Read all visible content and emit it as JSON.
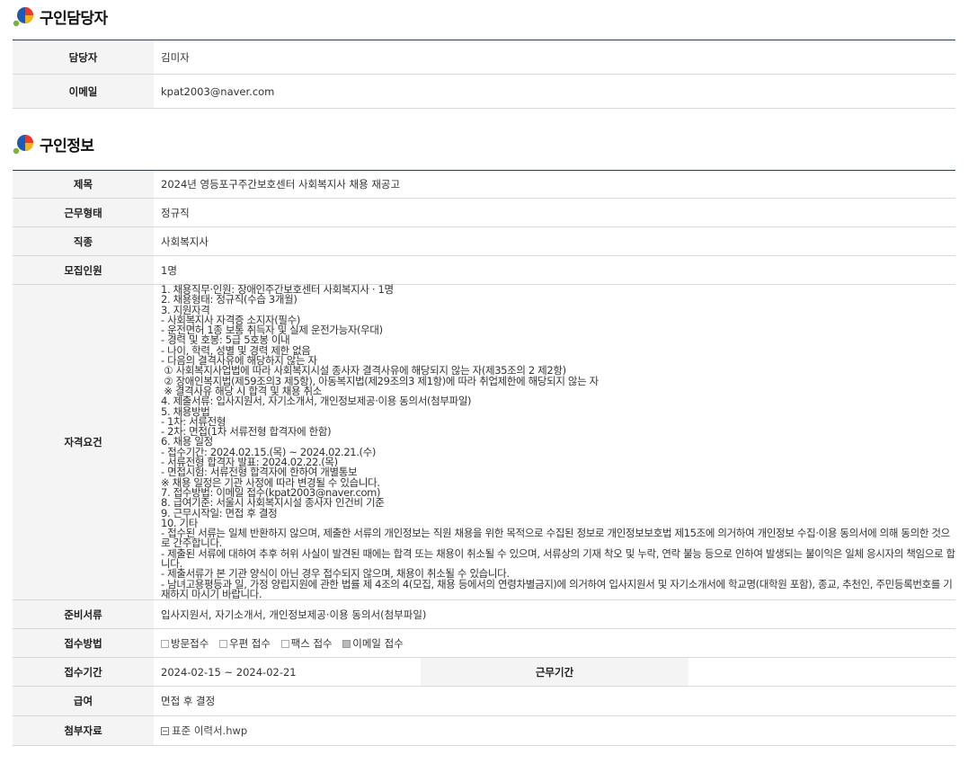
{
  "contact_section": {
    "title": "구인담당자",
    "rows": {
      "manager_label": "담당자",
      "manager_value": "김미자",
      "email_label": "이메일",
      "email_value": "kpat2003@naver.com"
    }
  },
  "job_section": {
    "title": "구인정보",
    "subject_label": "제목",
    "subject_value": "2024년 영등포구주간보호센터 사회복지사 채용 재공고",
    "worktype_label": "근무형태",
    "worktype_value": "정규직",
    "occupation_label": "직종",
    "occupation_value": "사회복지사",
    "headcount_label": "모집인원",
    "headcount_value": "1명",
    "requirements_label": "자격요건",
    "requirements_text": "1. 채용직무·인원: 장애인주간보호센터 사회복지사 · 1명\n2. 채용형태: 정규직(수습 3개월)\n3. 지원자격\n- 사회복지사 자격증 소지자(필수)\n- 운전면허 1종 보통 취득자 및 실제 운전가능자(우대)\n- 경력 및 호봉: 5급 5호봉 이내\n- 나이, 학력, 성별 및 경력 제한 없음\n- 다음의 결격사유에 해당하지 않는 자\n ① 사회복지사업법에 따라 사회복지시설 종사자 결격사유에 해당되지 않는 자(제35조의 2 제2항)\n ② 장애인복지법(제59조의3 제5항), 아동복지법(제29조의3 제1항)에 따라 취업제한에 해당되지 않는 자\n ※ 결격사유 해당 시 합격 및 채용 취소\n4. 제출서류: 입사지원서, 자기소개서, 개인정보제공·이용 동의서(첨부파일)\n5. 채용방법\n- 1차: 서류전형\n- 2차: 면접(1차 서류전형 합격자에 한함)\n6. 채용 일정\n- 접수기간: 2024.02.15.(목) ~ 2024.02.21.(수)\n- 서류전형 합격자 발표: 2024.02.22.(목)\n- 면접시험: 서류전형 합격자에 한하여 개별통보\n※ 채용 일정은 기관 사정에 따라 변경될 수 있습니다.\n7. 접수방법: 이메일 접수(kpat2003@naver.com)\n8. 급여기준: 서울시 사회복지시설 종사자 인건비 기준\n9. 근무시작일: 면접 후 결정\n10. 기타\n- 접수된 서류는 일체 반환하지 않으며, 제출한 서류의 개인정보는 직원 채용을 위한 목적으로 수집된 정보로 개인정보보호법 제15조에 의거하여 개인정보 수집·이용 동의서에 의해 동의한 것으로 간주합니다.\n- 제출된 서류에 대하여 추후 허위 사실이 발견된 때에는 합격 또는 채용이 취소될 수 있으며, 서류상의 기재 착오 및 누락, 연락 불능 등으로 인하여 발생되는 불이익은 일체 응시자의 책임으로 합니다.\n- 제출서류가 본 기관 양식이 아닌 경우 접수되지 않으며, 채용이 취소될 수 있습니다.\n- 남녀고용평등과 일, 가정 양립지원에 관한 법률 제 4조의 4(모집, 채용 등에서의 연령차별금지)에 의거하여 입사지원서 및 자기소개서에 학교명(대학원 포함), 종교, 추천인, 주민등록번호를 기재하지 마시기 바랍니다.",
    "docs_label": "준비서류",
    "docs_value": "입사지원서, 자기소개서, 개인정보제공·이용 동의서(첨부파일)",
    "method_label": "접수방법",
    "methods": [
      {
        "label": "방문접수",
        "checked": false
      },
      {
        "label": "우편 접수",
        "checked": false
      },
      {
        "label": "팩스 접수",
        "checked": false
      },
      {
        "label": "이메일 접수",
        "checked": true
      }
    ],
    "period_label": "접수기간",
    "period_value": "2024-02-15 ~ 2024-02-21",
    "work_period_label": "근무기간",
    "work_period_value": "",
    "salary_label": "급여",
    "salary_value": "면접 후 결정",
    "attach_label": "첨부자료",
    "attach_file": "표준 이력서.hwp"
  }
}
